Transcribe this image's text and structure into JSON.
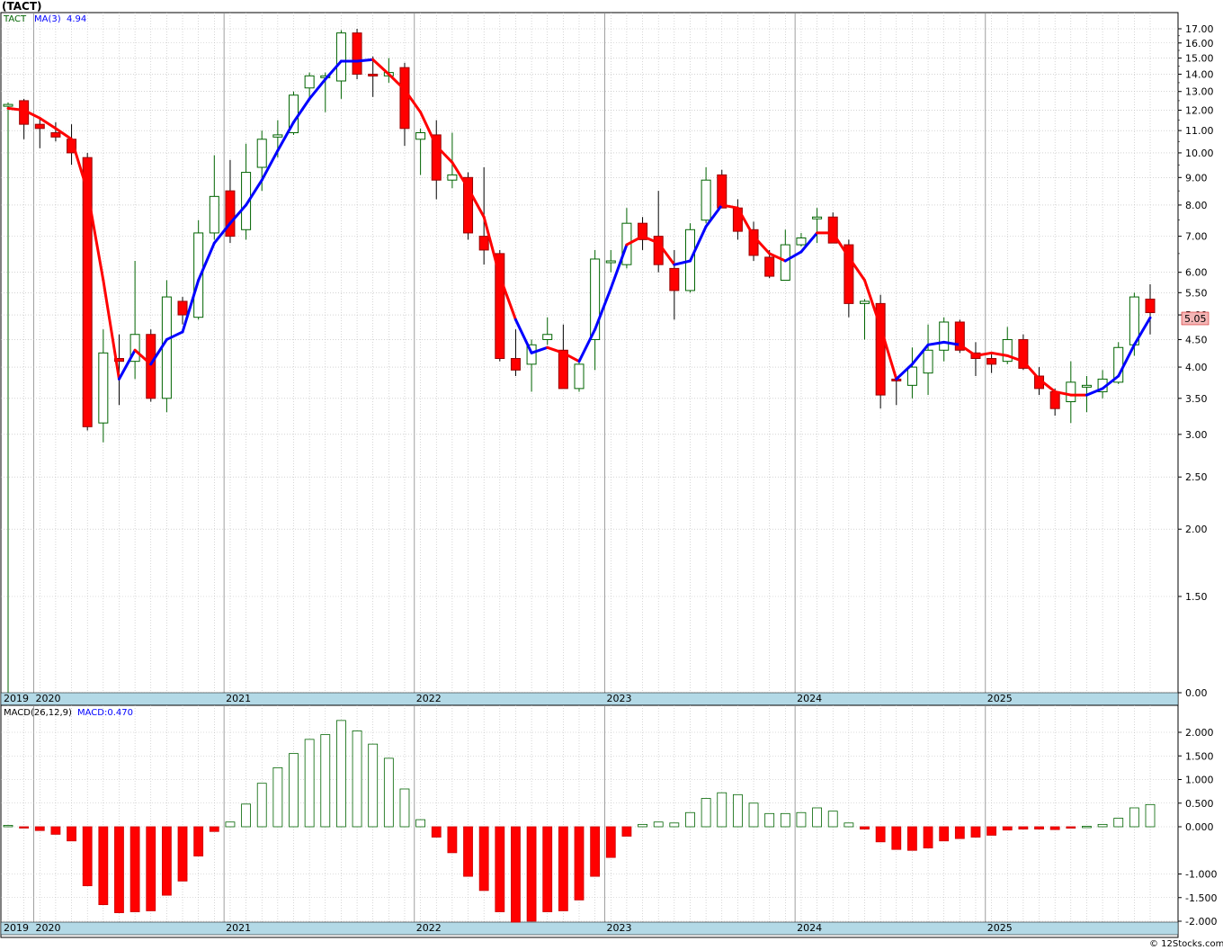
{
  "chart_data": [
    {
      "type": "candlestick",
      "title": "(TACT)",
      "symbol": "TACT",
      "legend": {
        "ma_label": "MA(3)",
        "ma_value": "4.94"
      },
      "last_price_label": "5.05",
      "log_scale": true,
      "ylim": [
        0,
        17.6
      ],
      "y_ticks": [
        "17.00",
        "16.00",
        "15.00",
        "14.00",
        "13.00",
        "12.00",
        "11.00",
        "10.00",
        "9.00",
        "8.00",
        "7.00",
        "6.00",
        "5.50",
        "5.00",
        "4.50",
        "4.00",
        "3.50",
        "3.00",
        "2.50",
        "2.00",
        "1.50",
        "0.00"
      ],
      "x_year_labels": [
        "2019",
        "2020",
        "2021",
        "2022",
        "2023",
        "2024",
        "2025"
      ],
      "colors": {
        "up": "#006400",
        "down": "#ff0000",
        "ma_up": "#0000ff",
        "ma_down": "#ff0000",
        "axis_band": "#b3d9e6",
        "grid": "#aaaaaa"
      },
      "candles": [
        {
          "m": "2019-11",
          "o": 12.3,
          "h": 12.4,
          "l": 0.0,
          "c": 12.3
        },
        {
          "m": "2019-12",
          "o": 12.5,
          "h": 12.6,
          "l": 10.6,
          "c": 11.3
        },
        {
          "m": "2020-01",
          "o": 11.3,
          "h": 11.6,
          "l": 10.2,
          "c": 11.1
        },
        {
          "m": "2020-02",
          "o": 10.9,
          "h": 11.4,
          "l": 10.5,
          "c": 10.7
        },
        {
          "m": "2020-03",
          "o": 10.6,
          "h": 11.3,
          "l": 9.5,
          "c": 10.0
        },
        {
          "m": "2020-04",
          "o": 9.8,
          "h": 10.0,
          "l": 3.05,
          "c": 3.1
        },
        {
          "m": "2020-05",
          "o": 3.15,
          "h": 4.7,
          "l": 2.9,
          "c": 4.25
        },
        {
          "m": "2020-06",
          "o": 4.15,
          "h": 4.6,
          "l": 3.4,
          "c": 4.1
        },
        {
          "m": "2020-07",
          "o": 4.1,
          "h": 6.3,
          "l": 3.8,
          "c": 4.6
        },
        {
          "m": "2020-08",
          "o": 4.6,
          "h": 4.7,
          "l": 3.45,
          "c": 3.5
        },
        {
          "m": "2020-09",
          "o": 3.5,
          "h": 5.8,
          "l": 3.3,
          "c": 5.4
        },
        {
          "m": "2020-10",
          "o": 5.3,
          "h": 5.4,
          "l": 4.8,
          "c": 5.0
        },
        {
          "m": "2020-11",
          "o": 4.95,
          "h": 7.5,
          "l": 4.9,
          "c": 7.1
        },
        {
          "m": "2020-12",
          "o": 7.1,
          "h": 9.9,
          "l": 6.9,
          "c": 8.3
        },
        {
          "m": "2021-01",
          "o": 8.5,
          "h": 9.7,
          "l": 6.8,
          "c": 7.0
        },
        {
          "m": "2021-02",
          "o": 7.2,
          "h": 10.4,
          "l": 6.9,
          "c": 9.2
        },
        {
          "m": "2021-03",
          "o": 9.4,
          "h": 11.0,
          "l": 8.5,
          "c": 10.6
        },
        {
          "m": "2021-04",
          "o": 10.7,
          "h": 11.5,
          "l": 9.8,
          "c": 10.8
        },
        {
          "m": "2021-05",
          "o": 10.9,
          "h": 13.0,
          "l": 10.8,
          "c": 12.8
        },
        {
          "m": "2021-06",
          "o": 13.2,
          "h": 14.1,
          "l": 12.5,
          "c": 13.9
        },
        {
          "m": "2021-07",
          "o": 13.8,
          "h": 14.1,
          "l": 11.9,
          "c": 13.9
        },
        {
          "m": "2021-08",
          "o": 13.6,
          "h": 16.9,
          "l": 12.6,
          "c": 16.7
        },
        {
          "m": "2021-09",
          "o": 16.7,
          "h": 17.0,
          "l": 13.7,
          "c": 14.0
        },
        {
          "m": "2021-10",
          "o": 14.0,
          "h": 15.1,
          "l": 12.7,
          "c": 13.9
        },
        {
          "m": "2021-11",
          "o": 13.9,
          "h": 15.0,
          "l": 13.5,
          "c": 14.1
        },
        {
          "m": "2021-12",
          "o": 14.4,
          "h": 14.7,
          "l": 10.3,
          "c": 11.1
        },
        {
          "m": "2022-01",
          "o": 10.6,
          "h": 11.1,
          "l": 9.1,
          "c": 10.9
        },
        {
          "m": "2022-02",
          "o": 10.8,
          "h": 11.5,
          "l": 8.2,
          "c": 8.9
        },
        {
          "m": "2022-03",
          "o": 8.9,
          "h": 10.9,
          "l": 8.6,
          "c": 9.1
        },
        {
          "m": "2022-04",
          "o": 9.0,
          "h": 9.2,
          "l": 6.9,
          "c": 7.1
        },
        {
          "m": "2022-05",
          "o": 7.0,
          "h": 9.4,
          "l": 6.2,
          "c": 6.6
        },
        {
          "m": "2022-06",
          "o": 6.5,
          "h": 6.6,
          "l": 4.1,
          "c": 4.15
        },
        {
          "m": "2022-07",
          "o": 4.15,
          "h": 4.7,
          "l": 3.85,
          "c": 3.95
        },
        {
          "m": "2022-08",
          "o": 4.05,
          "h": 4.5,
          "l": 3.6,
          "c": 4.4
        },
        {
          "m": "2022-09",
          "o": 4.5,
          "h": 4.95,
          "l": 4.4,
          "c": 4.6
        },
        {
          "m": "2022-10",
          "o": 4.3,
          "h": 4.8,
          "l": 3.65,
          "c": 3.65
        },
        {
          "m": "2022-11",
          "o": 3.65,
          "h": 4.15,
          "l": 3.6,
          "c": 4.05
        },
        {
          "m": "2022-12",
          "o": 4.5,
          "h": 6.6,
          "l": 3.95,
          "c": 6.35
        },
        {
          "m": "2023-01",
          "o": 6.3,
          "h": 6.6,
          "l": 6.0,
          "c": 6.3
        },
        {
          "m": "2023-02",
          "o": 6.2,
          "h": 7.9,
          "l": 6.1,
          "c": 7.4
        },
        {
          "m": "2023-03",
          "o": 7.4,
          "h": 7.6,
          "l": 6.6,
          "c": 6.9
        },
        {
          "m": "2023-04",
          "o": 7.0,
          "h": 8.5,
          "l": 6.0,
          "c": 6.2
        },
        {
          "m": "2023-05",
          "o": 6.1,
          "h": 6.6,
          "l": 4.9,
          "c": 5.55
        },
        {
          "m": "2023-06",
          "o": 5.55,
          "h": 7.4,
          "l": 5.5,
          "c": 7.2
        },
        {
          "m": "2023-07",
          "o": 7.5,
          "h": 9.4,
          "l": 7.4,
          "c": 8.9
        },
        {
          "m": "2023-08",
          "o": 9.1,
          "h": 9.3,
          "l": 7.9,
          "c": 7.9
        },
        {
          "m": "2023-09",
          "o": 7.9,
          "h": 8.2,
          "l": 6.9,
          "c": 7.15
        },
        {
          "m": "2023-10",
          "o": 7.2,
          "h": 7.45,
          "l": 6.3,
          "c": 6.45
        },
        {
          "m": "2023-11",
          "o": 6.4,
          "h": 6.6,
          "l": 5.85,
          "c": 5.9
        },
        {
          "m": "2023-12",
          "o": 5.8,
          "h": 7.2,
          "l": 5.8,
          "c": 6.75
        },
        {
          "m": "2024-01",
          "o": 6.75,
          "h": 7.1,
          "l": 6.7,
          "c": 6.95
        },
        {
          "m": "2024-02",
          "o": 7.6,
          "h": 7.9,
          "l": 6.8,
          "c": 7.6
        },
        {
          "m": "2024-03",
          "o": 7.6,
          "h": 7.75,
          "l": 6.8,
          "c": 6.8
        },
        {
          "m": "2024-04",
          "o": 6.75,
          "h": 6.9,
          "l": 4.95,
          "c": 5.25
        },
        {
          "m": "2024-05",
          "o": 5.25,
          "h": 5.35,
          "l": 4.5,
          "c": 5.3
        },
        {
          "m": "2024-06",
          "o": 5.25,
          "h": 5.45,
          "l": 3.35,
          "c": 3.55
        },
        {
          "m": "2024-07",
          "o": 3.8,
          "h": 3.85,
          "l": 3.4,
          "c": 3.78
        },
        {
          "m": "2024-08",
          "o": 3.7,
          "h": 4.35,
          "l": 3.5,
          "c": 4.0
        },
        {
          "m": "2024-09",
          "o": 3.9,
          "h": 4.8,
          "l": 3.55,
          "c": 4.3
        },
        {
          "m": "2024-10",
          "o": 4.3,
          "h": 4.95,
          "l": 4.1,
          "c": 4.85
        },
        {
          "m": "2024-11",
          "o": 4.85,
          "h": 4.9,
          "l": 4.25,
          "c": 4.3
        },
        {
          "m": "2024-12",
          "o": 4.25,
          "h": 4.45,
          "l": 3.85,
          "c": 4.15
        },
        {
          "m": "2025-01",
          "o": 4.15,
          "h": 4.25,
          "l": 3.9,
          "c": 4.05
        },
        {
          "m": "2025-02",
          "o": 4.1,
          "h": 4.75,
          "l": 4.05,
          "c": 4.5
        },
        {
          "m": "2025-03",
          "o": 4.5,
          "h": 4.6,
          "l": 3.95,
          "c": 3.98
        },
        {
          "m": "2025-04",
          "o": 3.85,
          "h": 4.0,
          "l": 3.55,
          "c": 3.65
        },
        {
          "m": "2025-05",
          "o": 3.6,
          "h": 3.65,
          "l": 3.25,
          "c": 3.35
        },
        {
          "m": "2025-06",
          "o": 3.45,
          "h": 4.1,
          "l": 3.15,
          "c": 3.75
        },
        {
          "m": "2025-07",
          "o": 3.7,
          "h": 3.85,
          "l": 3.3,
          "c": 3.7
        },
        {
          "m": "2025-08",
          "o": 3.6,
          "h": 3.95,
          "l": 3.5,
          "c": 3.8
        },
        {
          "m": "2025-09",
          "o": 3.75,
          "h": 4.45,
          "l": 3.72,
          "c": 4.35
        },
        {
          "m": "2025-10",
          "o": 4.4,
          "h": 5.5,
          "l": 4.2,
          "c": 5.4
        },
        {
          "m": "2025-11",
          "o": 5.35,
          "h": 5.7,
          "l": 4.6,
          "c": 5.05
        }
      ],
      "ma3": [
        12.1,
        12.0,
        11.6,
        11.1,
        10.6,
        8.5,
        5.8,
        3.8,
        4.3,
        4.05,
        4.5,
        4.65,
        5.8,
        6.8,
        7.4,
        8.0,
        8.9,
        10.1,
        11.4,
        12.6,
        13.7,
        14.8,
        14.8,
        14.9,
        14.0,
        13.1,
        11.9,
        10.3,
        9.6,
        8.6,
        7.6,
        5.9,
        4.9,
        4.25,
        4.35,
        4.25,
        4.1,
        4.7,
        5.6,
        6.75,
        7.0,
        6.8,
        6.2,
        6.3,
        7.3,
        8.0,
        7.9,
        7.0,
        6.5,
        6.3,
        6.55,
        7.1,
        7.1,
        6.4,
        5.8,
        4.75,
        3.8,
        4.05,
        4.4,
        4.45,
        4.4,
        4.2,
        4.25,
        4.2,
        4.1,
        3.8,
        3.6,
        3.55,
        3.55,
        3.65,
        3.85,
        4.4,
        4.94
      ],
      "ma3_colors": [
        "red",
        "red",
        "red",
        "red",
        "red",
        "red",
        "red",
        "red",
        "blue",
        "red",
        "blue",
        "blue",
        "blue",
        "blue",
        "blue",
        "blue",
        "blue",
        "blue",
        "blue",
        "blue",
        "blue",
        "blue",
        "blue",
        "blue",
        "red",
        "red",
        "red",
        "red",
        "red",
        "red",
        "red",
        "red",
        "red",
        "blue",
        "blue",
        "red",
        "red",
        "blue",
        "blue",
        "blue",
        "red",
        "red",
        "red",
        "blue",
        "blue",
        "blue",
        "red",
        "red",
        "red",
        "red",
        "blue",
        "blue",
        "red",
        "red",
        "red",
        "red",
        "red",
        "blue",
        "blue",
        "blue",
        "blue",
        "red",
        "red",
        "red",
        "red",
        "red",
        "red",
        "red",
        "red",
        "blue",
        "blue",
        "blue",
        "blue"
      ]
    },
    {
      "type": "bar",
      "title": "MACD(26,12,9)",
      "indicator_label": "MACD(26,12,9)",
      "value_label": "MACD:0.470",
      "ylim": [
        -2.0,
        2.2
      ],
      "y_ticks": [
        "2.000",
        "1.500",
        "1.000",
        "0.500",
        "0.000",
        "-1.000",
        "-1.500",
        "-2.000"
      ],
      "x_year_labels": [
        "2019",
        "2020",
        "2021",
        "2022",
        "2023",
        "2024",
        "2025"
      ],
      "values": [
        0.03,
        -0.02,
        -0.08,
        -0.16,
        -0.3,
        -1.25,
        -1.65,
        -1.82,
        -1.8,
        -1.78,
        -1.45,
        -1.15,
        -0.62,
        -0.1,
        0.1,
        0.48,
        0.92,
        1.25,
        1.55,
        1.85,
        1.95,
        2.25,
        2.03,
        1.75,
        1.45,
        0.8,
        0.15,
        -0.22,
        -0.55,
        -1.05,
        -1.35,
        -1.8,
        -2.02,
        -2.0,
        -1.8,
        -1.78,
        -1.55,
        -1.05,
        -0.65,
        -0.2,
        0.05,
        0.1,
        0.08,
        0.3,
        0.6,
        0.72,
        0.68,
        0.5,
        0.28,
        0.28,
        0.3,
        0.4,
        0.33,
        0.08,
        -0.05,
        -0.32,
        -0.48,
        -0.5,
        -0.45,
        -0.3,
        -0.25,
        -0.22,
        -0.18,
        -0.07,
        -0.05,
        -0.05,
        -0.06,
        -0.03,
        0.01,
        0.05,
        0.18,
        0.4,
        0.47
      ]
    }
  ],
  "footer": {
    "copyright": "© 12Stocks.com"
  }
}
